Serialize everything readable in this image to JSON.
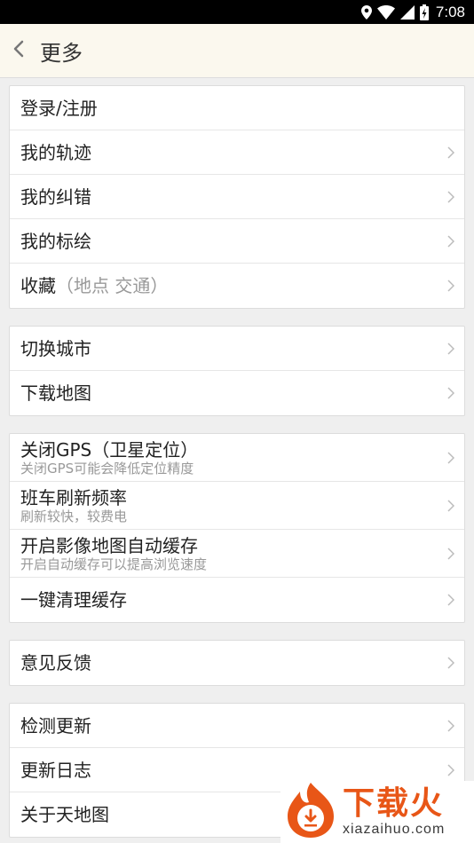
{
  "status_bar": {
    "time": "7:08",
    "icons": [
      "location-icon",
      "wifi-icon",
      "signal-icon",
      "battery-charging-icon"
    ]
  },
  "header": {
    "title": "更多",
    "back_icon": "chevron-left-icon"
  },
  "groups": [
    {
      "items": [
        {
          "title": "登录/注册",
          "has_chevron": false
        },
        {
          "title": "我的轨迹",
          "has_chevron": true
        },
        {
          "title": "我的纠错",
          "has_chevron": true
        },
        {
          "title": "我的标绘",
          "has_chevron": true
        },
        {
          "title": "收藏",
          "title_suffix": "（地点 交通）",
          "has_chevron": true
        }
      ]
    },
    {
      "items": [
        {
          "title": "切换城市",
          "has_chevron": true
        },
        {
          "title": "下载地图",
          "has_chevron": true
        }
      ]
    },
    {
      "items": [
        {
          "title": "关闭GPS（卫星定位）",
          "subtitle": "关闭GPS可能会降低定位精度",
          "has_chevron": true
        },
        {
          "title": "班车刷新频率",
          "subtitle": "刷新较快，较费电",
          "has_chevron": true
        },
        {
          "title": "开启影像地图自动缓存",
          "subtitle": "开启自动缓存可以提高浏览速度",
          "has_chevron": true
        },
        {
          "title": "一键清理缓存",
          "has_chevron": true
        }
      ]
    },
    {
      "items": [
        {
          "title": "意见反馈",
          "has_chevron": true
        }
      ]
    },
    {
      "items": [
        {
          "title": "检测更新",
          "has_chevron": true
        },
        {
          "title": "更新日志",
          "has_chevron": true
        },
        {
          "title": "关于天地图",
          "has_chevron": true
        }
      ]
    }
  ],
  "watermark": {
    "brand": "下载火",
    "url": "xiazaihuo.com",
    "logo_icon": "flame-download-icon"
  },
  "colors": {
    "header_bg": "#fbf8ee",
    "page_bg": "#efefef",
    "brand_orange": "#e85617"
  }
}
